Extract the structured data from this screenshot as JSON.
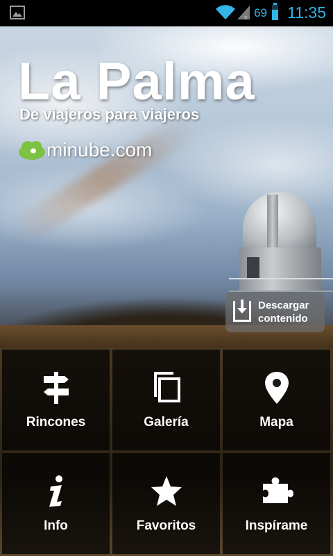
{
  "status_bar": {
    "battery_level": 69,
    "battery_text": "69",
    "time": "11:35",
    "accent_color": "#33b5e5",
    "icons": [
      "gallery-icon",
      "wifi-icon",
      "signal-icon",
      "battery-icon"
    ]
  },
  "hero": {
    "title": "La Palma",
    "subtitle": "De viajeros para viajeros",
    "brand": "minube.com",
    "download": {
      "label_line1": "Descargar",
      "label_line2": "contenido",
      "icon": "download-icon"
    }
  },
  "menu": {
    "items": [
      {
        "label": "Rincones",
        "icon": "signpost-icon"
      },
      {
        "label": "Galería",
        "icon": "gallery-stack-icon"
      },
      {
        "label": "Mapa",
        "icon": "map-pin-icon"
      },
      {
        "label": "Info",
        "icon": "info-icon"
      },
      {
        "label": "Favoritos",
        "icon": "star-icon"
      },
      {
        "label": "Inspírame",
        "icon": "puzzle-icon"
      }
    ]
  }
}
